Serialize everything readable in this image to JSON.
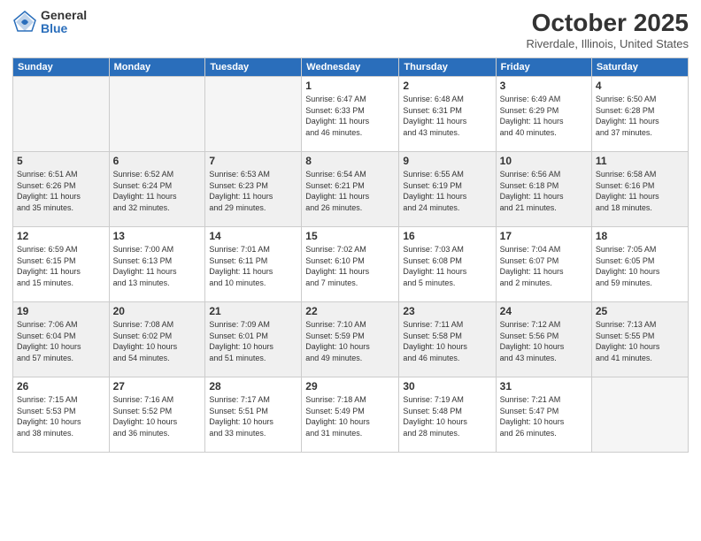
{
  "header": {
    "logo_general": "General",
    "logo_blue": "Blue",
    "title": "October 2025",
    "subtitle": "Riverdale, Illinois, United States"
  },
  "weekdays": [
    "Sunday",
    "Monday",
    "Tuesday",
    "Wednesday",
    "Thursday",
    "Friday",
    "Saturday"
  ],
  "weeks": [
    [
      {
        "day": "",
        "info": ""
      },
      {
        "day": "",
        "info": ""
      },
      {
        "day": "",
        "info": ""
      },
      {
        "day": "1",
        "info": "Sunrise: 6:47 AM\nSunset: 6:33 PM\nDaylight: 11 hours\nand 46 minutes."
      },
      {
        "day": "2",
        "info": "Sunrise: 6:48 AM\nSunset: 6:31 PM\nDaylight: 11 hours\nand 43 minutes."
      },
      {
        "day": "3",
        "info": "Sunrise: 6:49 AM\nSunset: 6:29 PM\nDaylight: 11 hours\nand 40 minutes."
      },
      {
        "day": "4",
        "info": "Sunrise: 6:50 AM\nSunset: 6:28 PM\nDaylight: 11 hours\nand 37 minutes."
      }
    ],
    [
      {
        "day": "5",
        "info": "Sunrise: 6:51 AM\nSunset: 6:26 PM\nDaylight: 11 hours\nand 35 minutes."
      },
      {
        "day": "6",
        "info": "Sunrise: 6:52 AM\nSunset: 6:24 PM\nDaylight: 11 hours\nand 32 minutes."
      },
      {
        "day": "7",
        "info": "Sunrise: 6:53 AM\nSunset: 6:23 PM\nDaylight: 11 hours\nand 29 minutes."
      },
      {
        "day": "8",
        "info": "Sunrise: 6:54 AM\nSunset: 6:21 PM\nDaylight: 11 hours\nand 26 minutes."
      },
      {
        "day": "9",
        "info": "Sunrise: 6:55 AM\nSunset: 6:19 PM\nDaylight: 11 hours\nand 24 minutes."
      },
      {
        "day": "10",
        "info": "Sunrise: 6:56 AM\nSunset: 6:18 PM\nDaylight: 11 hours\nand 21 minutes."
      },
      {
        "day": "11",
        "info": "Sunrise: 6:58 AM\nSunset: 6:16 PM\nDaylight: 11 hours\nand 18 minutes."
      }
    ],
    [
      {
        "day": "12",
        "info": "Sunrise: 6:59 AM\nSunset: 6:15 PM\nDaylight: 11 hours\nand 15 minutes."
      },
      {
        "day": "13",
        "info": "Sunrise: 7:00 AM\nSunset: 6:13 PM\nDaylight: 11 hours\nand 13 minutes."
      },
      {
        "day": "14",
        "info": "Sunrise: 7:01 AM\nSunset: 6:11 PM\nDaylight: 11 hours\nand 10 minutes."
      },
      {
        "day": "15",
        "info": "Sunrise: 7:02 AM\nSunset: 6:10 PM\nDaylight: 11 hours\nand 7 minutes."
      },
      {
        "day": "16",
        "info": "Sunrise: 7:03 AM\nSunset: 6:08 PM\nDaylight: 11 hours\nand 5 minutes."
      },
      {
        "day": "17",
        "info": "Sunrise: 7:04 AM\nSunset: 6:07 PM\nDaylight: 11 hours\nand 2 minutes."
      },
      {
        "day": "18",
        "info": "Sunrise: 7:05 AM\nSunset: 6:05 PM\nDaylight: 10 hours\nand 59 minutes."
      }
    ],
    [
      {
        "day": "19",
        "info": "Sunrise: 7:06 AM\nSunset: 6:04 PM\nDaylight: 10 hours\nand 57 minutes."
      },
      {
        "day": "20",
        "info": "Sunrise: 7:08 AM\nSunset: 6:02 PM\nDaylight: 10 hours\nand 54 minutes."
      },
      {
        "day": "21",
        "info": "Sunrise: 7:09 AM\nSunset: 6:01 PM\nDaylight: 10 hours\nand 51 minutes."
      },
      {
        "day": "22",
        "info": "Sunrise: 7:10 AM\nSunset: 5:59 PM\nDaylight: 10 hours\nand 49 minutes."
      },
      {
        "day": "23",
        "info": "Sunrise: 7:11 AM\nSunset: 5:58 PM\nDaylight: 10 hours\nand 46 minutes."
      },
      {
        "day": "24",
        "info": "Sunrise: 7:12 AM\nSunset: 5:56 PM\nDaylight: 10 hours\nand 43 minutes."
      },
      {
        "day": "25",
        "info": "Sunrise: 7:13 AM\nSunset: 5:55 PM\nDaylight: 10 hours\nand 41 minutes."
      }
    ],
    [
      {
        "day": "26",
        "info": "Sunrise: 7:15 AM\nSunset: 5:53 PM\nDaylight: 10 hours\nand 38 minutes."
      },
      {
        "day": "27",
        "info": "Sunrise: 7:16 AM\nSunset: 5:52 PM\nDaylight: 10 hours\nand 36 minutes."
      },
      {
        "day": "28",
        "info": "Sunrise: 7:17 AM\nSunset: 5:51 PM\nDaylight: 10 hours\nand 33 minutes."
      },
      {
        "day": "29",
        "info": "Sunrise: 7:18 AM\nSunset: 5:49 PM\nDaylight: 10 hours\nand 31 minutes."
      },
      {
        "day": "30",
        "info": "Sunrise: 7:19 AM\nSunset: 5:48 PM\nDaylight: 10 hours\nand 28 minutes."
      },
      {
        "day": "31",
        "info": "Sunrise: 7:21 AM\nSunset: 5:47 PM\nDaylight: 10 hours\nand 26 minutes."
      },
      {
        "day": "",
        "info": ""
      }
    ]
  ]
}
